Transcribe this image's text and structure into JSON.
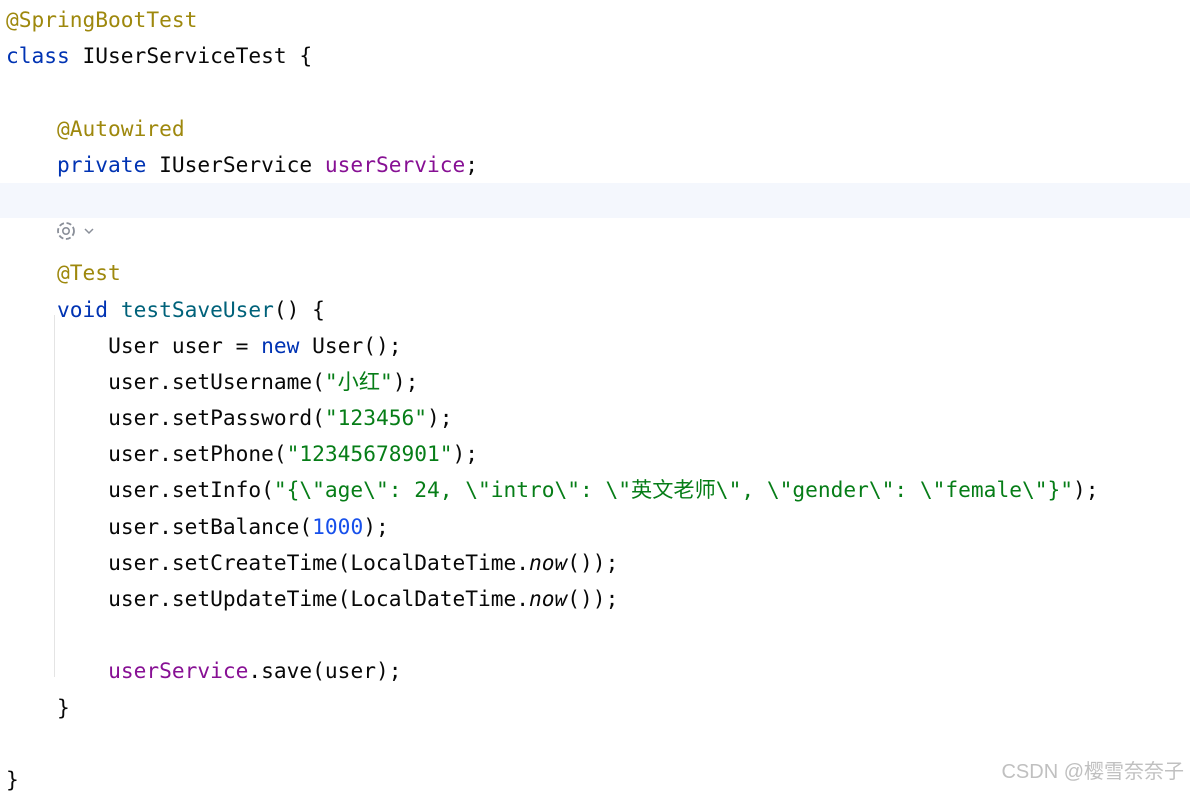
{
  "code": {
    "annotation_class": "@SpringBootTest",
    "class_keyword": "class",
    "class_name": " IUserServiceTest {",
    "annotation_autowired": "@Autowired",
    "private_keyword": "private",
    "field_type": " IUserService ",
    "field_name": "userService",
    "field_end": ";",
    "annotation_test": "@Test",
    "void_keyword": "void",
    "method_name": "testSaveUser",
    "method_sig_end": "() {",
    "line_new_user_a": "User user = ",
    "line_new_user_kw": "new",
    "line_new_user_b": " User();",
    "set_username_a": "user.setUsername(",
    "set_username_str": "\"小红\"",
    "set_username_b": ");",
    "set_password_a": "user.setPassword(",
    "set_password_str": "\"123456\"",
    "set_password_b": ");",
    "set_phone_a": "user.setPhone(",
    "set_phone_str": "\"12345678901\"",
    "set_phone_b": ");",
    "set_info_a": "user.setInfo(",
    "set_info_str": "\"{\\\"age\\\": 24, \\\"intro\\\": \\\"英文老师\\\", \\\"gender\\\": \\\"female\\\"}\"",
    "set_info_b": ");",
    "set_balance_a": "user.setBalance(",
    "set_balance_num": "1000",
    "set_balance_b": ");",
    "set_create_a": "user.setCreateTime(LocalDateTime.",
    "set_create_now": "now",
    "set_create_b": "());",
    "set_update_a": "user.setUpdateTime(LocalDateTime.",
    "set_update_now": "now",
    "set_update_b": "());",
    "save_field": "userService",
    "save_rest": ".save(user);",
    "method_close": "}",
    "class_close": "}"
  },
  "gutter": {
    "run_icon": "run-test-icon",
    "dropdown_icon": "chevron-down-icon"
  },
  "watermark": "CSDN @樱雪奈奈子",
  "colors": {
    "annotation": "#9e880d",
    "keyword": "#0033b3",
    "field": "#871094",
    "string": "#067d17",
    "number": "#1750eb",
    "method_declaration": "#00627a",
    "current_line": "#f4f7fd"
  }
}
